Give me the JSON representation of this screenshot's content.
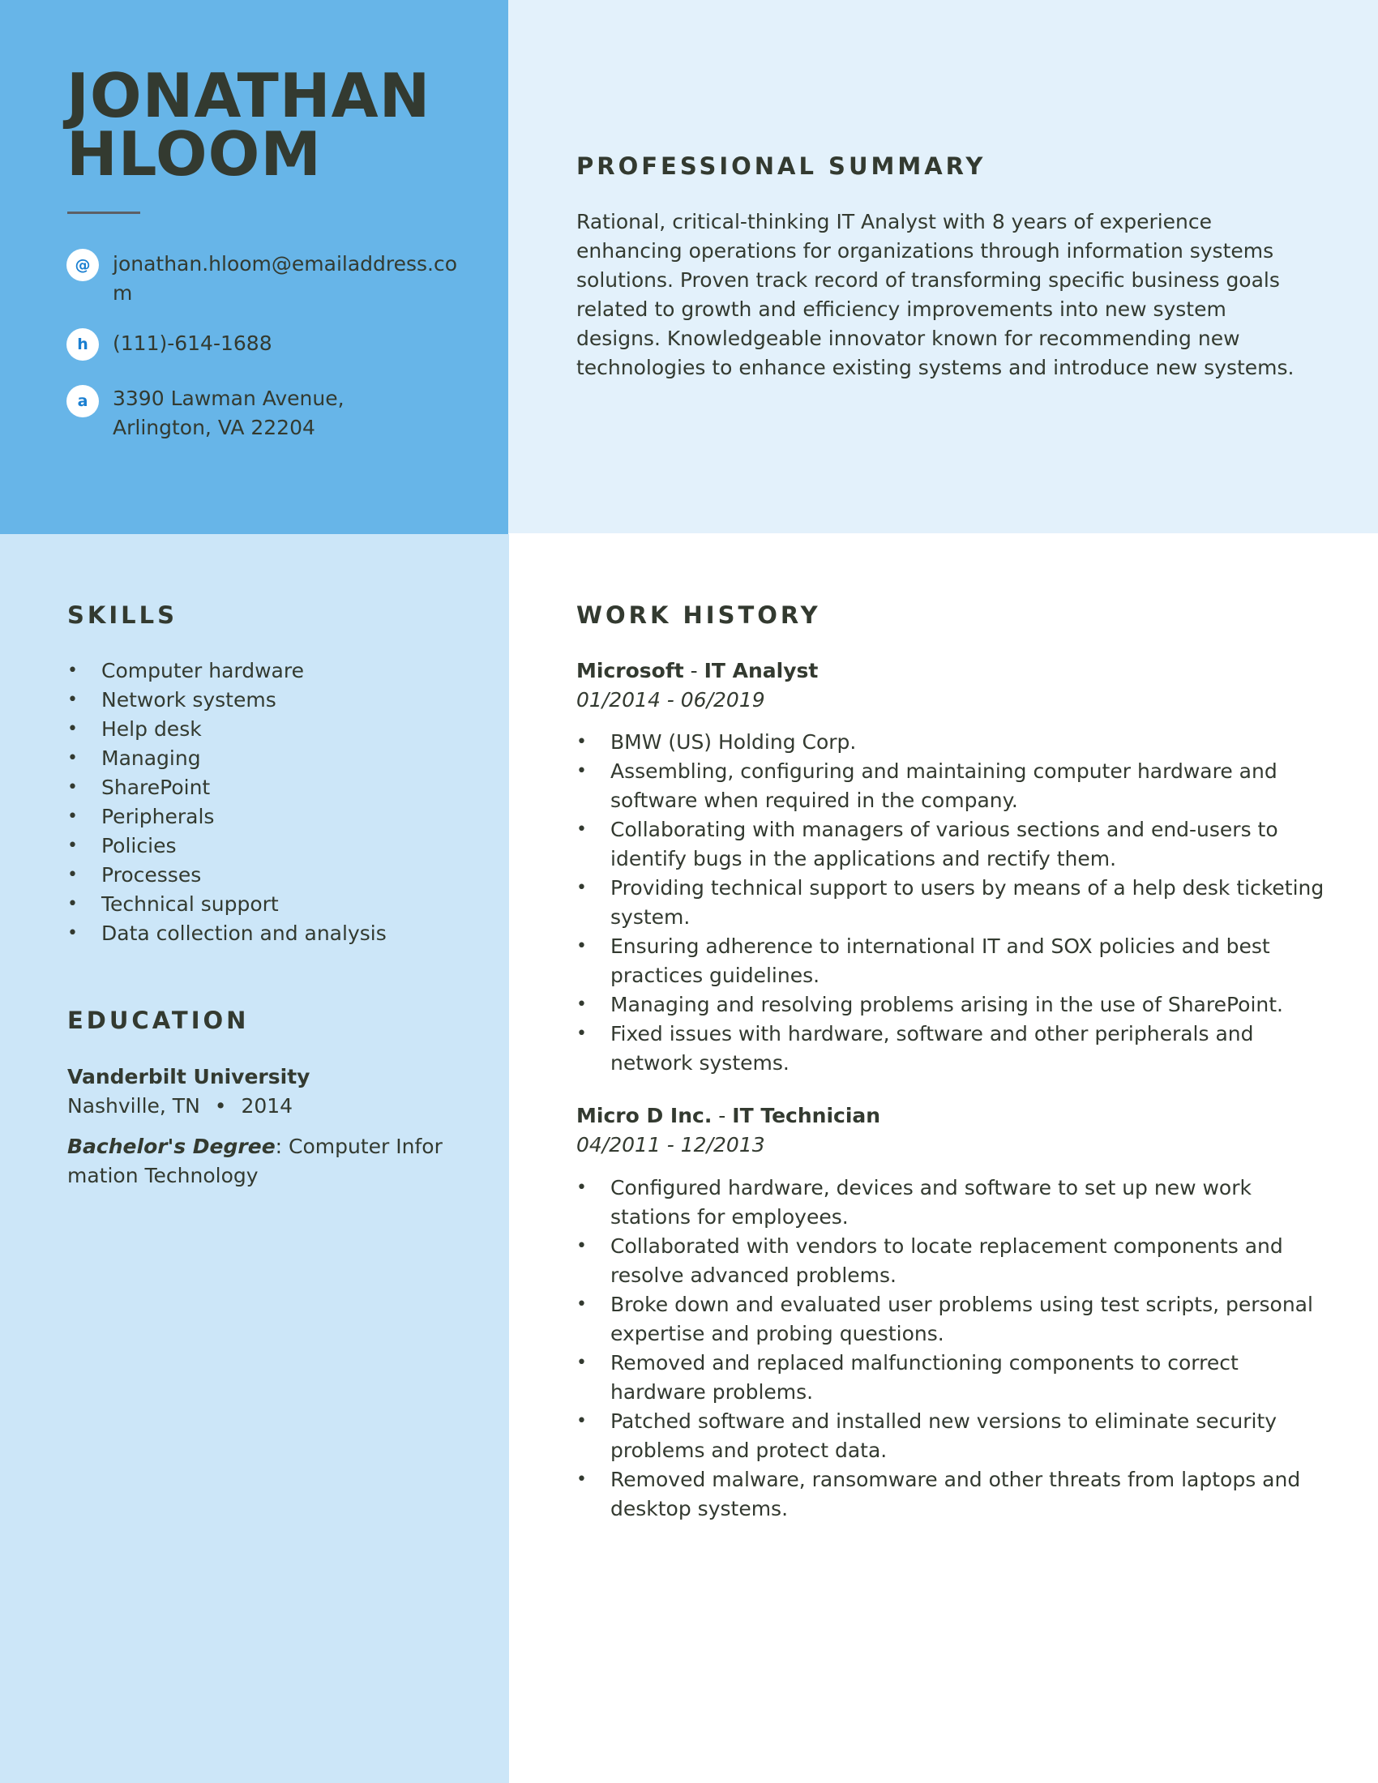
{
  "name": {
    "first": "JONATHAN",
    "last": "HLOOM"
  },
  "contact": [
    {
      "icon": "email-icon",
      "glyph": "@",
      "text": "jonathan.hloom@emailaddress.com"
    },
    {
      "icon": "phone-icon",
      "glyph": "h",
      "text": "(111)-614-1688"
    },
    {
      "icon": "address-icon",
      "glyph": "a",
      "text": "3390 Lawman Avenue, Arlington, VA 22204"
    }
  ],
  "summary": {
    "title": "PROFESSIONAL SUMMARY",
    "text": "Rational, critical-thinking IT Analyst with 8 years of experience enhancing operations for organizations through information systems solutions. Proven track record of transforming specific business goals related to growth and efficiency improvements into new system designs. Knowledgeable innovator known for recommending new technologies to enhance existing systems and introduce new systems."
  },
  "skills": {
    "title": "SKILLS",
    "bullet": "•",
    "items": [
      "Computer hardware",
      "Network systems",
      "Help desk",
      "Managing",
      "SharePoint",
      "Peripherals",
      "Policies",
      "Processes",
      "Technical support",
      "Data collection and analysis"
    ]
  },
  "education": {
    "title": "EDUCATION",
    "school": "Vanderbilt University",
    "location": "Nashville, TN",
    "separator": "•",
    "year": "2014",
    "degree_type": "Bachelor's Degree",
    "degree_sep": ":",
    "field": "Computer Information Technology"
  },
  "work": {
    "title": "WORK HISTORY",
    "jobs": [
      {
        "company": "Microsoft",
        "sep": " - ",
        "role": "IT Analyst",
        "dates": "01/2014 - 06/2019",
        "bullets": [
          "BMW (US) Holding Corp.",
          "Assembling, configuring and maintaining computer hardware and software when required in the company.",
          "Collaborating with managers of various sections and end-users to identify bugs in the applications and rectify them.",
          "Providing technical support to users by means of a help desk ticketing system.",
          "Ensuring adherence to international IT and SOX policies and best practices guidelines.",
          "Managing and resolving problems arising in the use of SharePoint.",
          "Fixed issues with hardware, software and other peripherals and network systems."
        ]
      },
      {
        "company": "Micro D Inc.",
        "sep": " - ",
        "role": "IT Technician",
        "dates": "04/2011 - 12/2013",
        "bullets": [
          "Configured hardware, devices and software to set up new work stations for employees.",
          "Collaborated with vendors to locate replacement components and resolve advanced problems.",
          "Broke down and evaluated user problems using test scripts, personal expertise and probing questions.",
          "Removed and replaced malfunctioning components to correct hardware problems.",
          "Patched software and installed new versions to eliminate security problems and protect data.",
          "Removed malware, ransomware and other threats from laptops and desktop systems."
        ]
      }
    ]
  },
  "colors": {
    "header_left": "#67b5e8",
    "header_right": "#e3f1fb",
    "body_left": "#cce6f8",
    "body_right": "#ffffff",
    "text": "#333a30",
    "icon_glyph": "#1a7fd1"
  }
}
